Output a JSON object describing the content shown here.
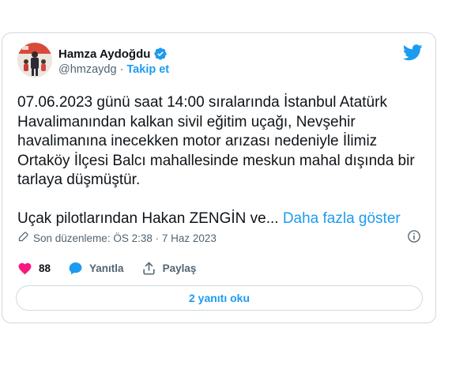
{
  "tweet": {
    "author_name": "Hamza Aydoğdu",
    "handle": "@hmzaydg",
    "separator": "·",
    "follow_label": "Takip et",
    "text_p1": "07.06.2023 günü saat 14:00 sıralarında İstanbul Atatürk Havalimanından kalkan sivil eğitim uçağı, Nevşehir havalimanına inecekken motor arızası nedeniyle İlimiz Ortaköy İlçesi Balcı mahallesinde meskun mahal dışında bir tarlaya düşmüştür.",
    "text_p2": "Uçak pilotlarından Hakan ZENGİN ve...",
    "show_more_label": "Daha fazla göster",
    "edited_label": "Son düzenleme: ÖS 2:38 · 7 Haz 2023",
    "like_count": "88",
    "reply_label": "Yanıtla",
    "share_label": "Paylaş",
    "replies_button_label": "2 yanıtı oku"
  },
  "colors": {
    "accent": "#1d9bf0",
    "like": "#f91880",
    "secondary_text": "#536471",
    "border": "#cfd9de"
  },
  "icons": [
    "verified-badge-icon",
    "twitter-bird-icon",
    "pencil-icon",
    "info-icon",
    "heart-icon",
    "reply-bubble-icon",
    "share-icon"
  ]
}
